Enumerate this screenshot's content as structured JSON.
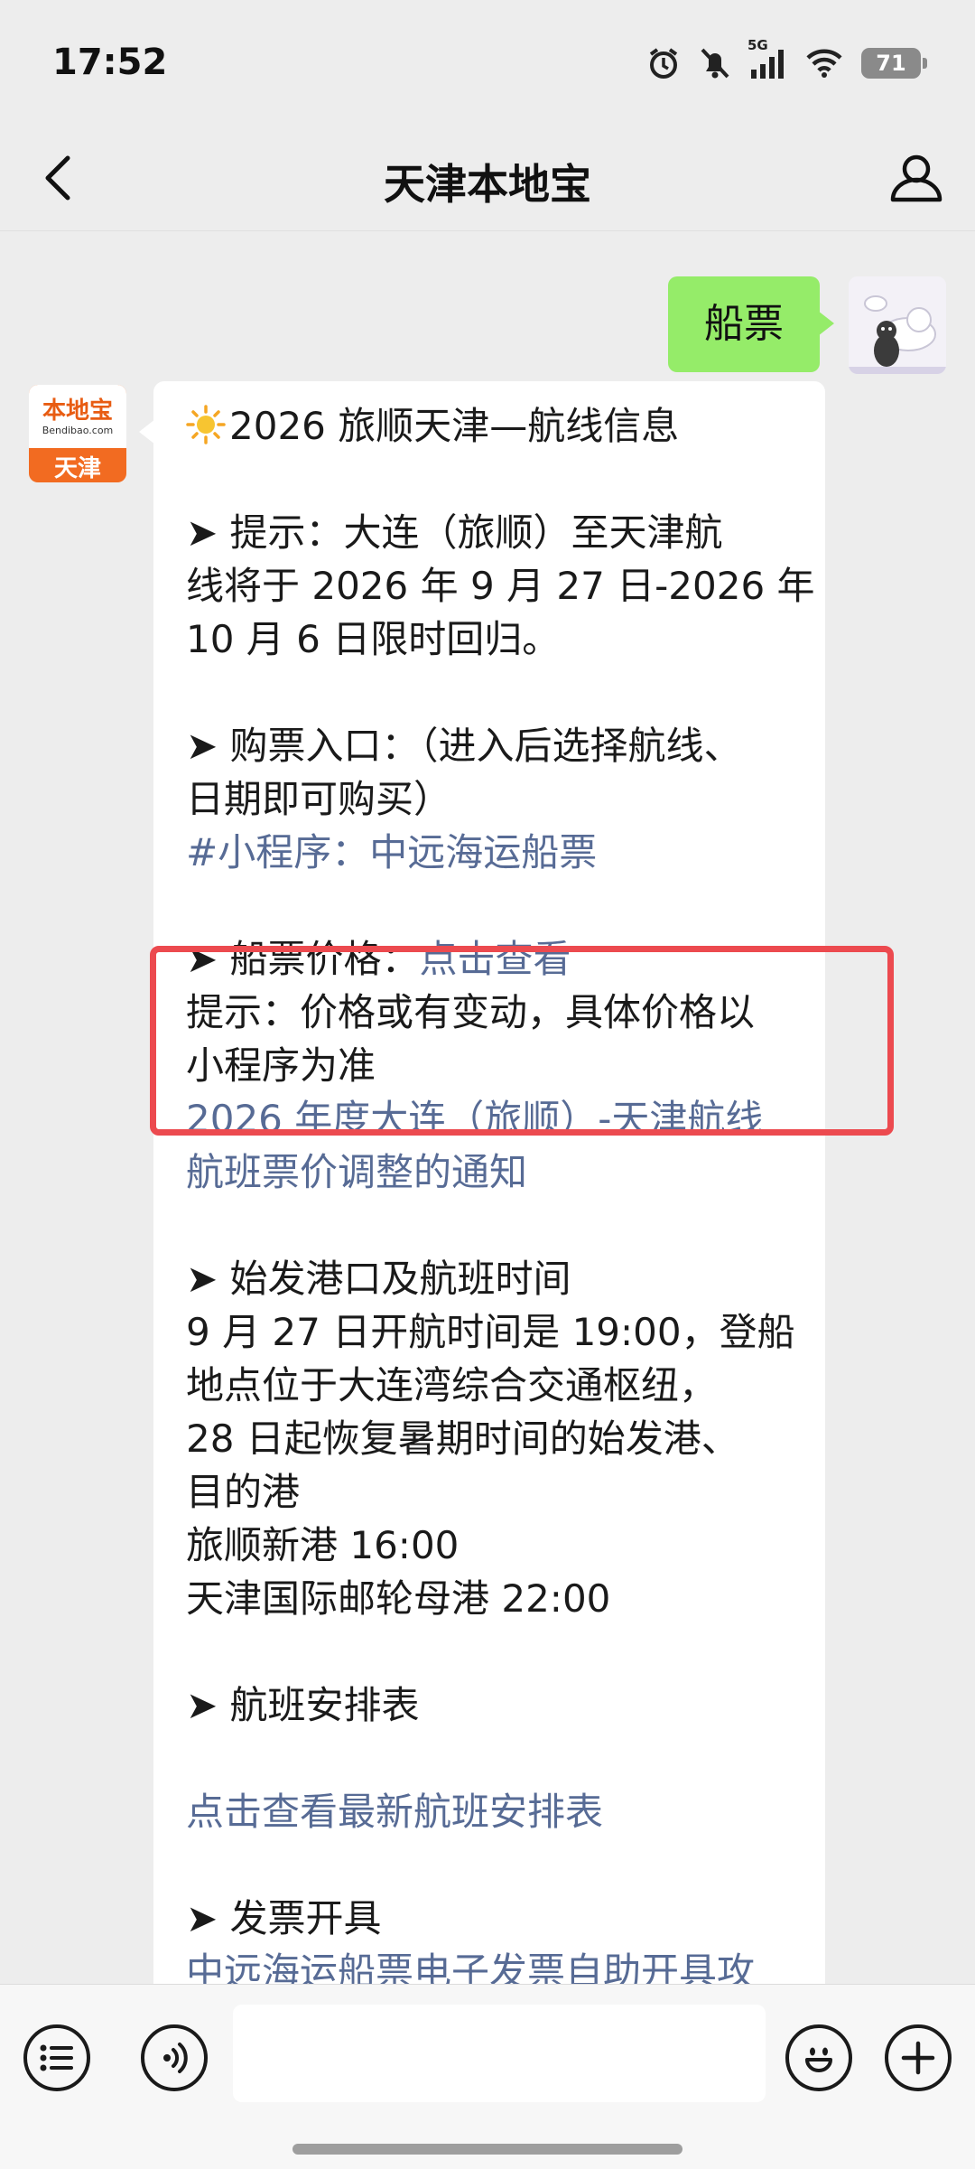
{
  "status_bar": {
    "time": "17:52",
    "network": "5G",
    "battery": "71",
    "icons": [
      "alarm-icon",
      "mute-icon",
      "signal-icon",
      "wifi-icon",
      "battery-icon"
    ]
  },
  "header": {
    "title": "天津本地宝",
    "back_icon": "chevron-left-icon",
    "profile_icon": "person-icon"
  },
  "outgoing_message": {
    "text": "船票"
  },
  "bot_avatar": {
    "logo_text": "本地宝",
    "site_text": "Bendibao.com",
    "city_text": "天津"
  },
  "message": {
    "title": "2026 旅顺天津—航线信息",
    "tip": {
      "lines": [
        "➤ 提示：大连（旅顺）至天津航",
        "线将于 2026 年 9 月 27 日-2026 年",
        "10 月 6 日限时回归。"
      ]
    },
    "purchase": {
      "lines": [
        "➤ 购票入口：（进入后选择航线、",
        "日期即可购买）"
      ],
      "link": "#小程序：中远海运船票"
    },
    "price": {
      "label": "➤ 船票价格：",
      "link": "点击查看",
      "lines": [
        "提示：价格或有变动，具体价格以",
        "小程序为准"
      ],
      "notice_links": [
        "2026 年度大连（旅顺）-天津航线",
        "航班票价调整的通知"
      ]
    },
    "departure": {
      "lines": [
        "➤ 始发港口及航班时间",
        "9 月 27 日开航时间是 19:00，登船",
        "地点位于大连湾综合交通枢纽，",
        "28 日起恢复暑期时间的始发港、",
        "目的港",
        "旅顺新港 16:00",
        "天津国际邮轮母港 22:00"
      ]
    },
    "schedule": {
      "label": "➤ 航班安排表",
      "link": "点击查看最新航班安排表"
    },
    "invoice": {
      "label": "➤ 发票开具",
      "link": "中远海运船票电子发票自助开具攻"
    }
  },
  "input_bar": {
    "menu_icon": "list-icon",
    "voice_icon": "voice-icon",
    "emoji_icon": "emoji-icon",
    "plus_icon": "plus-icon"
  },
  "colors": {
    "background": "#ededed",
    "outgoing_bubble": "#95ec69",
    "link": "#576b95",
    "highlight": "#ec4a4f",
    "bot_brand": "#f26b21"
  }
}
